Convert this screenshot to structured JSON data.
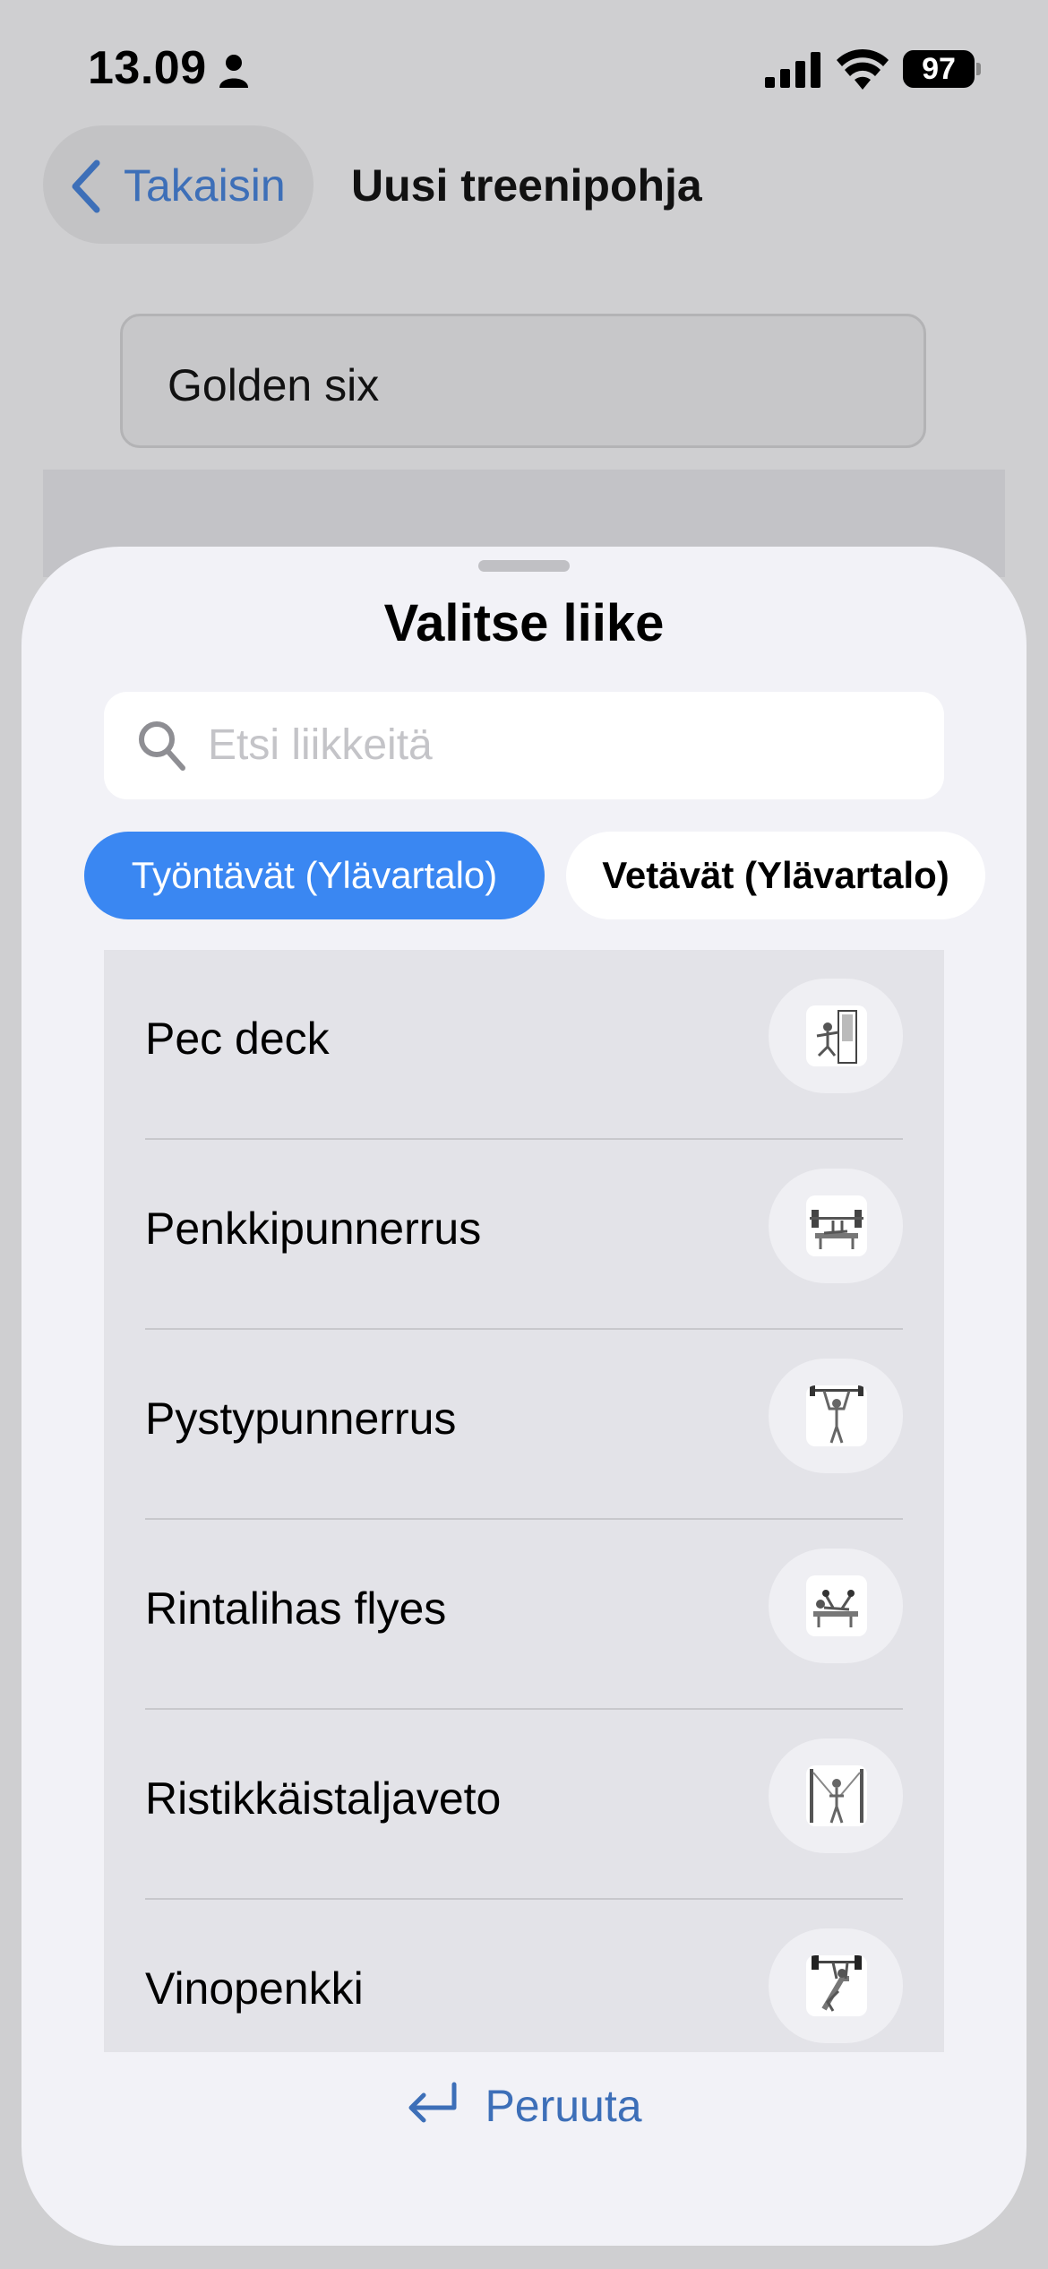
{
  "status_bar": {
    "time": "13.09",
    "battery": "97"
  },
  "nav": {
    "back_label": "Takaisin",
    "title": "Uusi treenipohja"
  },
  "template_name": {
    "value": "Golden six"
  },
  "sheet": {
    "title": "Valitse liike",
    "search": {
      "placeholder": "Etsi liikkeitä"
    },
    "chips": [
      {
        "label": "Työntävät (Ylävartalo)",
        "selected": true
      },
      {
        "label": "Vetävät (Ylävartalo)",
        "selected": false
      }
    ],
    "exercises": [
      {
        "label": "Pec deck",
        "icon": "pec-deck-machine-icon"
      },
      {
        "label": "Penkkipunnerrus",
        "icon": "bench-press-icon"
      },
      {
        "label": "Pystypunnerrus",
        "icon": "overhead-press-icon"
      },
      {
        "label": "Rintalihas flyes",
        "icon": "chest-flyes-icon"
      },
      {
        "label": "Ristikkäistaljaveto",
        "icon": "cable-crossover-icon"
      },
      {
        "label": "Vinopenkki",
        "icon": "incline-bench-icon"
      }
    ],
    "cancel_label": "Peruuta"
  },
  "colors": {
    "accent": "#3a87f2",
    "link": "#3d6fb8",
    "sheet_bg": "#f2f2f7",
    "list_bg": "#e3e3e8"
  }
}
